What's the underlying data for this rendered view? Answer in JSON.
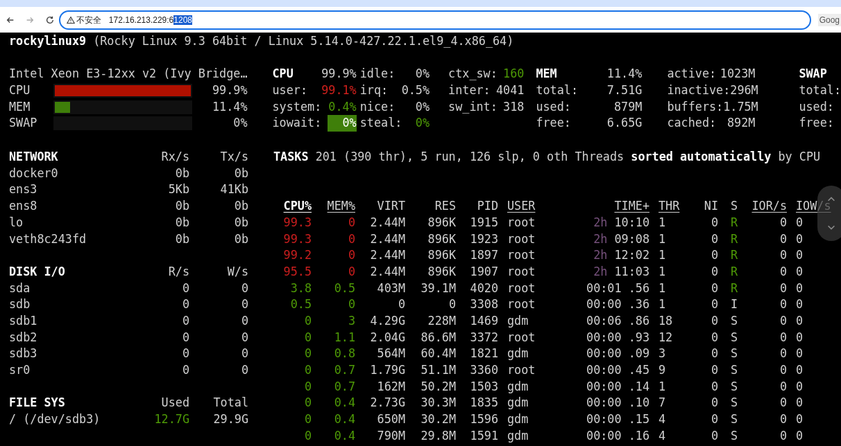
{
  "browser": {
    "security_label": "不安全",
    "url": "172.16.213.229:6",
    "url_selected": "1208",
    "side_text": "Goog"
  },
  "host": {
    "name": "rockylinux9",
    "system": "(Rocky Linux 9.3 64bit / Linux 5.14.0-427.22.1.el9_4.x86_64)"
  },
  "quicklook": {
    "cpu_name": "Intel Xeon E3-12xx v2 (Ivy Bridge…",
    "bars": [
      {
        "label": "CPU",
        "level": 0.999,
        "value": "99.9%",
        "color": "#b01000"
      },
      {
        "label": "MEM",
        "level": 0.114,
        "value": "11.4%",
        "color": "#3f7f0a"
      },
      {
        "label": "SWAP",
        "value": "0%"
      }
    ]
  },
  "cpu": {
    "title": "CPU",
    "total": "99.9%",
    "col1": [
      {
        "label": "user:",
        "value": "99.1%",
        "color": "#d0201c",
        "highlighted": false
      },
      {
        "label": "system:",
        "value": "0.4%",
        "color": "#4e9a06",
        "highlighted": false
      },
      {
        "label": "iowait:",
        "value": "0%",
        "highlighted": true
      }
    ],
    "col2": [
      {
        "label": "idle:",
        "value": "0%",
        "color": "#d0d0d0"
      },
      {
        "label": "irq:",
        "value": "0.5%",
        "color": "#d0d0d0"
      },
      {
        "label": "nice:",
        "value": "0%",
        "color": "#d0d0d0"
      },
      {
        "label": "steal:",
        "value": "0%",
        "color": "#4e9a06"
      }
    ],
    "col3": [
      {
        "label": "ctx_sw:",
        "value": "160",
        "color": "#4e9a06"
      },
      {
        "label": "inter:",
        "value": "4041",
        "color": "#d0d0d0"
      },
      {
        "label": "sw_int:",
        "value": "318",
        "color": "#d0d0d0"
      }
    ]
  },
  "mem": {
    "title": "MEM",
    "percent": "11.4%",
    "col1": [
      {
        "label": "total:",
        "value": "7.51G"
      },
      {
        "label": "used:",
        "value": "879M"
      },
      {
        "label": "free:",
        "value": "6.65G"
      }
    ],
    "col2": [
      {
        "label": "active:",
        "value": "1023M"
      },
      {
        "label": "inactive:",
        "value": "296M"
      },
      {
        "label": "buffers:",
        "value": "1.75M"
      },
      {
        "label": "cached:",
        "value": "892M"
      }
    ]
  },
  "swap": {
    "title": "SWAP",
    "labels": [
      "total:",
      "used:",
      "free:"
    ]
  },
  "network": {
    "title": "NETWORK",
    "col_rx": "Rx/s",
    "col_tx": "Tx/s",
    "rows": [
      {
        "name": "docker0",
        "rx": "0b",
        "tx": "0b"
      },
      {
        "name": "ens3",
        "rx": "5Kb",
        "tx": "41Kb"
      },
      {
        "name": "ens8",
        "rx": "0b",
        "tx": "0b"
      },
      {
        "name": "lo",
        "rx": "0b",
        "tx": "0b"
      },
      {
        "name": "veth8c243fd",
        "rx": "0b",
        "tx": "0b"
      }
    ]
  },
  "disk_io": {
    "title": "DISK I/O",
    "col_r": "R/s",
    "col_w": "W/s",
    "rows": [
      {
        "name": "sda",
        "r": "0",
        "w": "0"
      },
      {
        "name": "sdb",
        "r": "0",
        "w": "0"
      },
      {
        "name": "sdb1",
        "r": "0",
        "w": "0"
      },
      {
        "name": "sdb2",
        "r": "0",
        "w": "0"
      },
      {
        "name": "sdb3",
        "r": "0",
        "w": "0"
      },
      {
        "name": "sr0",
        "r": "0",
        "w": "0"
      }
    ]
  },
  "file_sys": {
    "title": "FILE SYS",
    "col_used": "Used",
    "col_total": "Total",
    "rows": [
      {
        "name": "/ (/dev/sdb3)",
        "used": {
          "value": "12.7G",
          "color": "#4e9a06"
        },
        "total": "29.9G"
      }
    ]
  },
  "tasks": "**TASKS** 201 (390 thr), 5 run, 126 slp, 0 oth Threads **sorted automatically** by CPU",
  "processes": {
    "columns": [
      {
        "label": "CPU%",
        "underlined": true,
        "sorted": true
      },
      {
        "label": "MEM%",
        "underlined": true,
        "sorted": false
      },
      {
        "label": "VIRT",
        "underlined": false,
        "sorted": false
      },
      {
        "label": "RES",
        "underlined": false,
        "sorted": false
      },
      {
        "label": "PID",
        "underlined": false,
        "sorted": false
      },
      {
        "label": "USER",
        "underlined": true,
        "sorted": false
      },
      {
        "label": "TIME+",
        "underlined": true,
        "sorted": false
      },
      {
        "label": "THR",
        "underlined": true,
        "sorted": false
      },
      {
        "label": "NI",
        "underlined": false,
        "sorted": false
      },
      {
        "label": "S",
        "underlined": false,
        "sorted": false
      },
      {
        "label": "IOR/s",
        "underlined": true,
        "sorted": false
      },
      {
        "label": "IOW/s",
        "underlined": true,
        "sorted": false
      }
    ],
    "rows": [
      {
        "cpu": {
          "value": "99.3",
          "color": "#cc1e1e"
        },
        "mem": {
          "value": "0",
          "color": "#cc1e1e"
        },
        "virt": "2.44M",
        "res": "896K",
        "pid": "1915",
        "user": "root",
        "time_hours": "2h",
        "time": "10:10",
        "thr": "1",
        "ni": "0",
        "s": {
          "value": "R",
          "color": "#4e9a06"
        },
        "ior": "0",
        "iow": "0"
      },
      {
        "cpu": {
          "value": "99.3",
          "color": "#cc1e1e"
        },
        "mem": {
          "value": "0",
          "color": "#cc1e1e"
        },
        "virt": "2.44M",
        "res": "896K",
        "pid": "1923",
        "user": "root",
        "time_hours": "2h",
        "time": "09:08",
        "thr": "1",
        "ni": "0",
        "s": {
          "value": "R",
          "color": "#4e9a06"
        },
        "ior": "0",
        "iow": "0"
      },
      {
        "cpu": {
          "value": "99.2",
          "color": "#cc1e1e"
        },
        "mem": {
          "value": "0",
          "color": "#cc1e1e"
        },
        "virt": "2.44M",
        "res": "896K",
        "pid": "1897",
        "user": "root",
        "time_hours": "2h",
        "time": "12:02",
        "thr": "1",
        "ni": "0",
        "s": {
          "value": "R",
          "color": "#4e9a06"
        },
        "ior": "0",
        "iow": "0"
      },
      {
        "cpu": {
          "value": "95.5",
          "color": "#cc1e1e"
        },
        "mem": {
          "value": "0",
          "color": "#cc1e1e"
        },
        "virt": "2.44M",
        "res": "896K",
        "pid": "1907",
        "user": "root",
        "time_hours": "2h",
        "time": "11:03",
        "thr": "1",
        "ni": "0",
        "s": {
          "value": "R",
          "color": "#4e9a06"
        },
        "ior": "0",
        "iow": "0"
      },
      {
        "cpu": {
          "value": "3.8",
          "color": "#4e9a06"
        },
        "mem": {
          "value": "0.5",
          "color": "#4e9a06"
        },
        "virt": "403M",
        "res": "39.1M",
        "pid": "4020",
        "user": "root",
        "time": "00:01 .56",
        "thr": "1",
        "ni": "0",
        "s": {
          "value": "R",
          "color": "#4e9a06"
        },
        "ior": "0",
        "iow": "0"
      },
      {
        "cpu": {
          "value": "0.5",
          "color": "#4e9a06"
        },
        "mem": {
          "value": "0",
          "color": "#4e9a06"
        },
        "virt": "0",
        "res": "0",
        "pid": "3308",
        "user": "root",
        "time": "00:00 .36",
        "thr": "1",
        "ni": "0",
        "s": {
          "value": "I",
          "color": "#d0d0d0"
        },
        "ior": "0",
        "iow": "0"
      },
      {
        "cpu": {
          "value": "0",
          "color": "#4e9a06"
        },
        "mem": {
          "value": "3",
          "color": "#4e9a06"
        },
        "virt": "4.29G",
        "res": "228M",
        "pid": "1469",
        "user": "gdm",
        "time": "00:06 .86",
        "thr": "18",
        "ni": "0",
        "s": {
          "value": "S",
          "color": "#d0d0d0"
        },
        "ior": "0",
        "iow": "0"
      },
      {
        "cpu": {
          "value": "0",
          "color": "#4e9a06"
        },
        "mem": {
          "value": "1.1",
          "color": "#4e9a06"
        },
        "virt": "2.04G",
        "res": "86.6M",
        "pid": "3372",
        "user": "root",
        "time": "00:00 .93",
        "thr": "12",
        "ni": "0",
        "s": {
          "value": "S",
          "color": "#d0d0d0"
        },
        "ior": "0",
        "iow": "0"
      },
      {
        "cpu": {
          "value": "0",
          "color": "#4e9a06"
        },
        "mem": {
          "value": "0.8",
          "color": "#4e9a06"
        },
        "virt": "564M",
        "res": "60.4M",
        "pid": "1821",
        "user": "gdm",
        "time": "00:00 .09",
        "thr": "3",
        "ni": "0",
        "s": {
          "value": "S",
          "color": "#d0d0d0"
        },
        "ior": "0",
        "iow": "0"
      },
      {
        "cpu": {
          "value": "0",
          "color": "#4e9a06"
        },
        "mem": {
          "value": "0.7",
          "color": "#4e9a06"
        },
        "virt": "1.79G",
        "res": "51.1M",
        "pid": "3360",
        "user": "root",
        "time": "00:00 .45",
        "thr": "9",
        "ni": "0",
        "s": {
          "value": "S",
          "color": "#d0d0d0"
        },
        "ior": "0",
        "iow": "0"
      },
      {
        "cpu": {
          "value": "0",
          "color": "#4e9a06"
        },
        "mem": {
          "value": "0.7",
          "color": "#4e9a06"
        },
        "virt": "162M",
        "res": "50.2M",
        "pid": "1503",
        "user": "gdm",
        "time": "00:00 .14",
        "thr": "1",
        "ni": "0",
        "s": {
          "value": "S",
          "color": "#d0d0d0"
        },
        "ior": "0",
        "iow": "0"
      },
      {
        "cpu": {
          "value": "0",
          "color": "#4e9a06"
        },
        "mem": {
          "value": "0.4",
          "color": "#4e9a06"
        },
        "virt": "2.73G",
        "res": "30.3M",
        "pid": "1835",
        "user": "gdm",
        "time": "00:00 .10",
        "thr": "7",
        "ni": "0",
        "s": {
          "value": "S",
          "color": "#d0d0d0"
        },
        "ior": "0",
        "iow": "0"
      },
      {
        "cpu": {
          "value": "0",
          "color": "#4e9a06"
        },
        "mem": {
          "value": "0.4",
          "color": "#4e9a06"
        },
        "virt": "650M",
        "res": "30.2M",
        "pid": "1596",
        "user": "gdm",
        "time": "00:00 .15",
        "thr": "4",
        "ni": "0",
        "s": {
          "value": "S",
          "color": "#d0d0d0"
        },
        "ior": "0",
        "iow": "0"
      },
      {
        "cpu": {
          "value": "0",
          "color": "#4e9a06"
        },
        "mem": {
          "value": "0.4",
          "color": "#4e9a06"
        },
        "virt": "790M",
        "res": "29.8M",
        "pid": "1591",
        "user": "gdm",
        "time": "00:00 .16",
        "thr": "4",
        "ni": "0",
        "s": {
          "value": "S",
          "color": "#d0d0d0"
        },
        "ior": "0",
        "iow": "0"
      }
    ]
  }
}
